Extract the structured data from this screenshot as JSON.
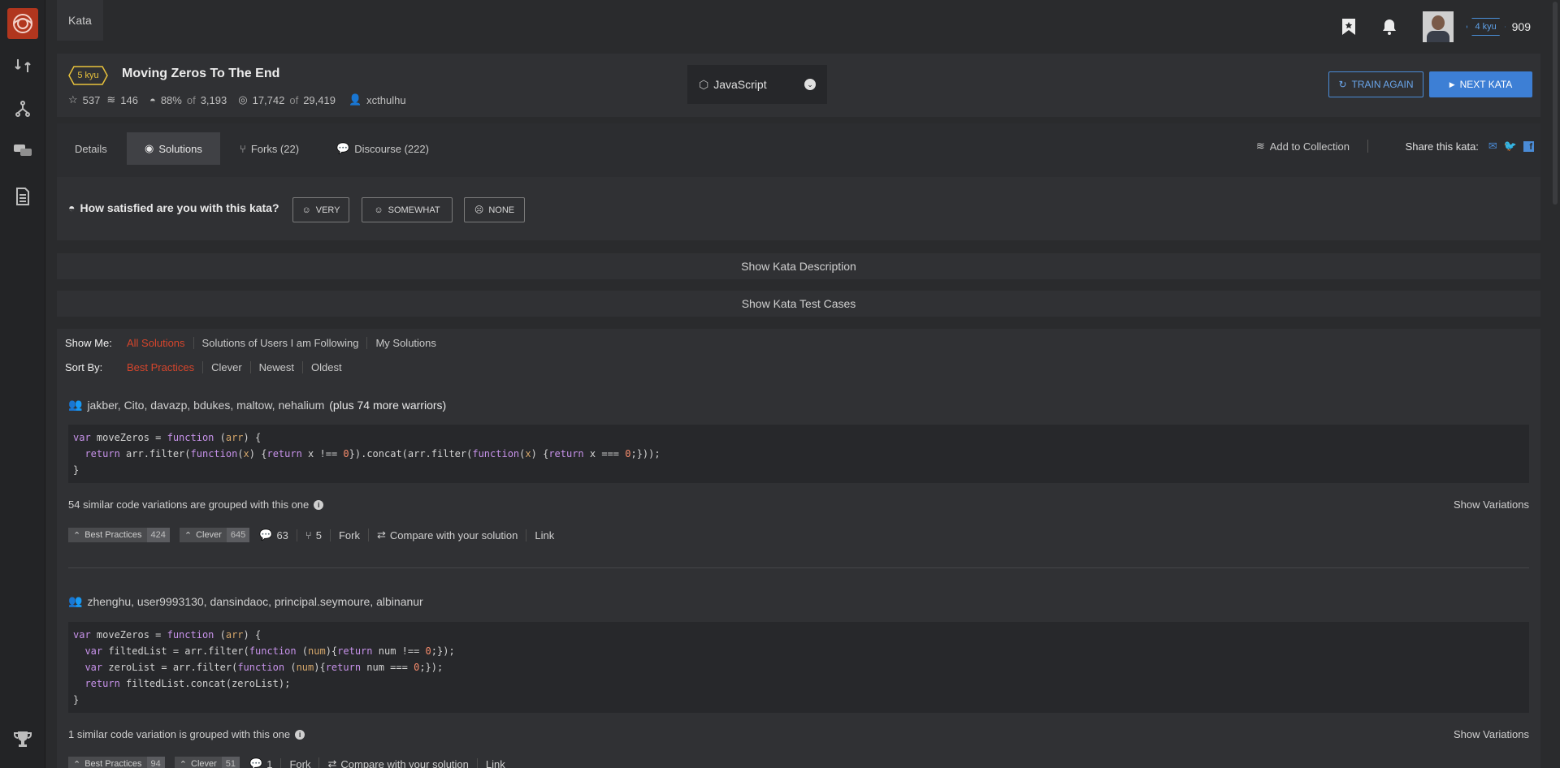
{
  "breadcrumb": "Kata",
  "user": {
    "rank": "4 kyu",
    "honor": "909"
  },
  "kata": {
    "rank": "5 kyu",
    "title": "Moving Zeros To The End",
    "stars": "537",
    "collections": "146",
    "satisfaction": "88%",
    "satisfaction_of_label": "of",
    "satisfaction_votes": "3,193",
    "completed": "17,742",
    "completed_of_label": "of",
    "attempts": "29,419",
    "author": "xcthulhu"
  },
  "language": "JavaScript",
  "buttons": {
    "train_again": "TRAIN AGAIN",
    "next_kata": "NEXT KATA"
  },
  "tabs": [
    {
      "label": "Details"
    },
    {
      "label": "Solutions"
    },
    {
      "label": "Forks (22)"
    },
    {
      "label": "Discourse (222)"
    }
  ],
  "add_collection": "Add to Collection",
  "share_label": "Share this kata:",
  "satisfaction": {
    "question": "How satisfied are you with this kata?",
    "very": "VERY",
    "somewhat": "SOMEWHAT",
    "none": "NONE"
  },
  "toggles": {
    "description": "Show Kata Description",
    "tests": "Show Kata Test Cases"
  },
  "filters": {
    "show_label": "Show Me:",
    "show_options": [
      "All Solutions",
      "Solutions of Users I am Following",
      "My Solutions"
    ],
    "sort_label": "Sort By:",
    "sort_options": [
      "Best Practices",
      "Clever",
      "Newest",
      "Oldest"
    ]
  },
  "solutions": [
    {
      "warriors": "jakber, Cito, davazp, bdukes, maltow, nehalium",
      "more": "(plus 74 more warriors)",
      "variations": "54 similar code variations are grouped with this one",
      "show_variations": "Show Variations",
      "best_practices": "424",
      "clever": "645",
      "comments": "63",
      "forks": "5"
    },
    {
      "warriors": "zhenghu, user9993130, dansindaoc, principal.seymoure, albinanur",
      "more": "",
      "variations": "1 similar code variation is grouped with this one",
      "show_variations": "Show Variations",
      "best_practices": "94",
      "clever": "51",
      "comments": "1",
      "forks": ""
    }
  ],
  "action_labels": {
    "best_practices": "Best Practices",
    "clever": "Clever",
    "fork": "Fork",
    "compare": "Compare with your solution",
    "link": "Link"
  }
}
